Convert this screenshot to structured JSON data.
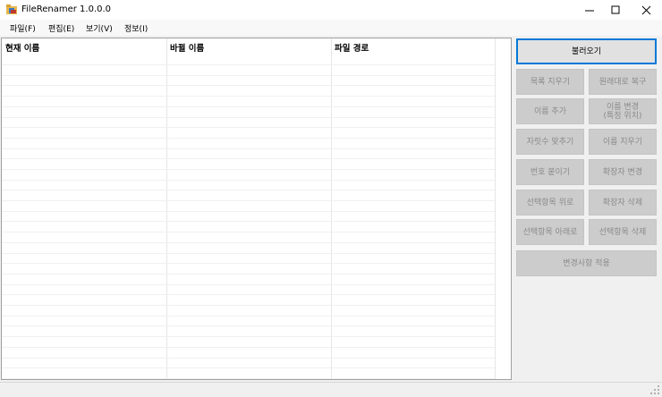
{
  "window": {
    "title": "FileRenamer 1.0.0.0",
    "minimize_icon": "minimize-icon",
    "maximize_icon": "maximize-icon",
    "close_icon": "close-icon"
  },
  "menu": [
    "파일(F)",
    "편집(E)",
    "보기(V)",
    "정보(I)"
  ],
  "list": {
    "columns": [
      "현재 이름",
      "바뀔 이름",
      "파일 경로"
    ],
    "rows": []
  },
  "buttons": {
    "load": "불러오기",
    "clear_list": "목록 지우기",
    "restore": "원래대로 복구",
    "add_name": "이름 추가",
    "rename_position": "이름 변경\n(특정 위치)",
    "pad_digits": "자릿수 맞추기",
    "delete_name": "이름 지우기",
    "numbering": "번호 붙이기",
    "change_ext": "확장자 변경",
    "move_up": "선택항목 위로",
    "delete_ext": "확장자 삭제",
    "move_down": "선택항목 아래로",
    "delete_selected": "선택항목 삭제",
    "apply": "변경사항 적용"
  },
  "colors": {
    "accent_border": "#0078d7",
    "disabled_button": "#cccccc",
    "disabled_text": "#8a8a8a"
  }
}
